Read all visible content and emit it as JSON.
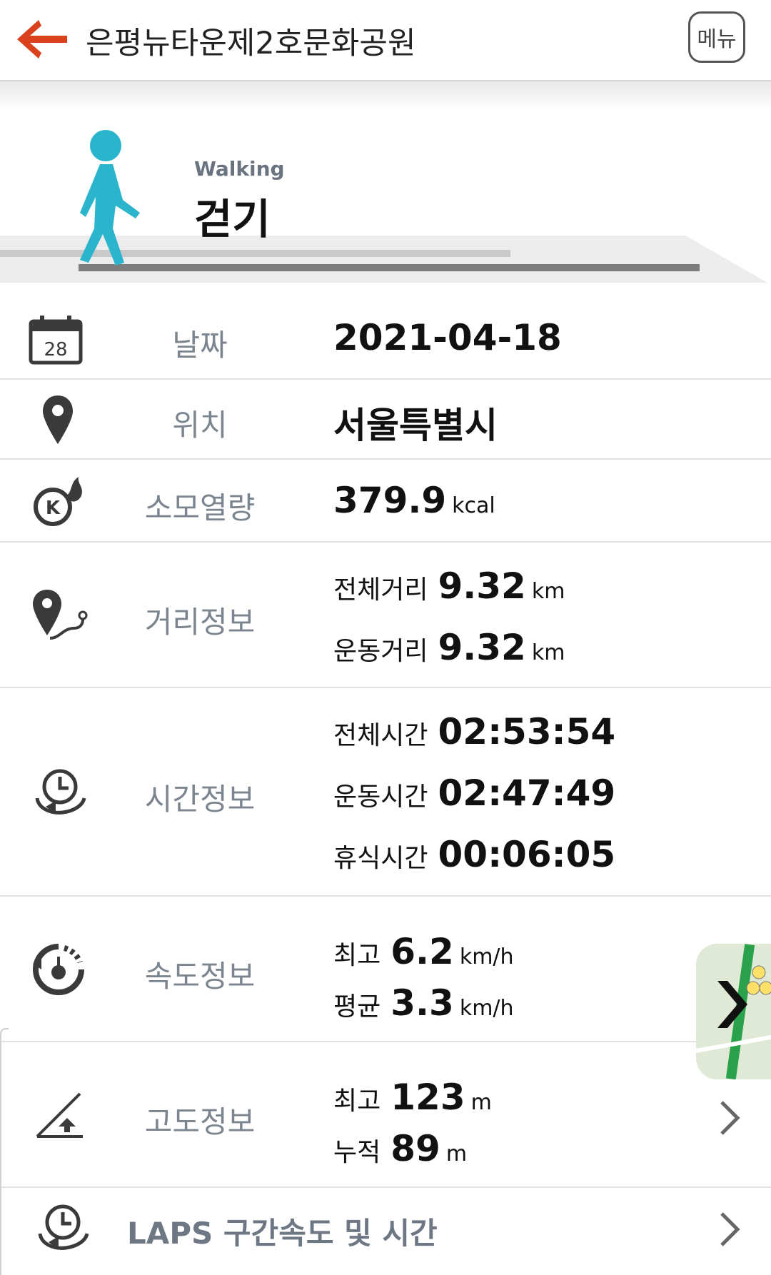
{
  "header": {
    "title": "은평뉴타운제2호문화공원",
    "menu_label": "메뉴",
    "back_icon": "back-arrow-icon",
    "accent_color": "#d9421c"
  },
  "activity": {
    "name_en": "Walking",
    "name_ko": "걷기",
    "icon": "walking-person-icon",
    "icon_color": "#2bb5cc"
  },
  "rows": {
    "date": {
      "label": "날짜",
      "value": "2021-04-18",
      "calendar_day": "28"
    },
    "location": {
      "label": "위치",
      "value": "서울특별시"
    },
    "calories": {
      "label": "소모열량",
      "value": "379.9",
      "unit": "kcal"
    },
    "distance": {
      "label": "거리정보",
      "total_label": "전체거리",
      "total_value": "9.32",
      "total_unit": "km",
      "exercise_label": "운동거리",
      "exercise_value": "9.32",
      "exercise_unit": "km"
    },
    "time": {
      "label": "시간정보",
      "total_label": "전체시간",
      "total_value": "02:53:54",
      "exercise_label": "운동시간",
      "exercise_value": "02:47:49",
      "rest_label": "휴식시간",
      "rest_value": "00:06:05"
    },
    "speed": {
      "label": "속도정보",
      "max_label": "최고",
      "max_value": "6.2",
      "max_unit": "km/h",
      "avg_label": "평균",
      "avg_value": "3.3",
      "avg_unit": "km/h"
    },
    "altitude": {
      "label": "고도정보",
      "max_label": "최고",
      "max_value": "123",
      "max_unit": "m",
      "cum_label": "누적",
      "cum_value": "89",
      "cum_unit": "m"
    },
    "laps": {
      "label": "LAPS 구간속도 및 시간"
    }
  }
}
